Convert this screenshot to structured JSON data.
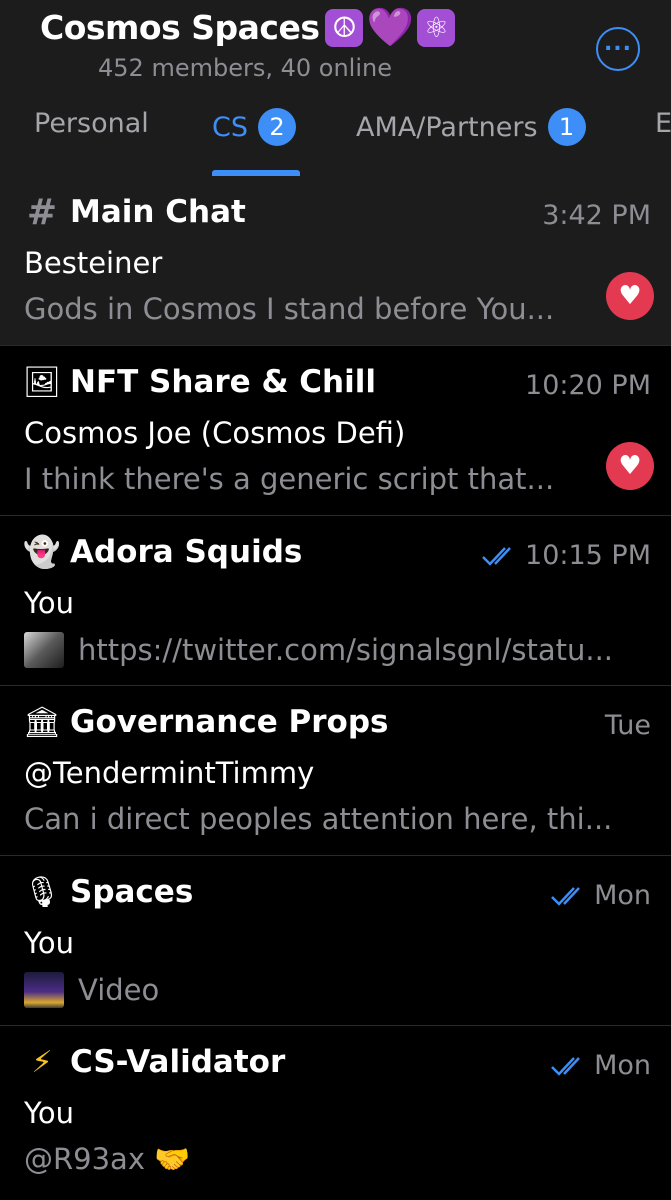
{
  "header": {
    "title": "Cosmos Spaces",
    "title_emojis": [
      "☮",
      "💜",
      "⚛"
    ],
    "subtitle": "452 members, 40 online",
    "more_icon": "ellipsis-circle-icon"
  },
  "tabs": [
    {
      "label": "Personal",
      "badge": ""
    },
    {
      "label": "CS",
      "badge": "2"
    },
    {
      "label": "AMA/Partners",
      "badge": "1"
    },
    {
      "label": "E",
      "badge": ""
    }
  ],
  "active_tab": "CS",
  "accent_color": "#3e8ef7",
  "reaction_color": "#e33a51",
  "chats": [
    {
      "icon": "hash-icon",
      "icon_glyph": "#",
      "name": "Main Chat",
      "time": "3:42 PM",
      "read_check": false,
      "sender": "Besteiner",
      "preview": "Gods in Cosmos I stand before You...",
      "preview_thumb": "",
      "reaction": "heart-icon"
    },
    {
      "icon": "nft-emoji-icon",
      "icon_glyph": "🖼",
      "name": "NFT Share & Chill",
      "time": "10:20 PM",
      "read_check": false,
      "sender": "Cosmos Joe (Cosmos Defi)",
      "preview": "I think there's a generic script that...",
      "preview_thumb": "",
      "reaction": "heart-icon"
    },
    {
      "icon": "squid-emoji-icon",
      "icon_glyph": "👻",
      "name": "Adora Squids",
      "time": "10:15 PM",
      "read_check": true,
      "sender": "You",
      "preview": "https://twitter.com/signalsgnl/statu...",
      "preview_thumb": "twitter-thumb",
      "reaction": ""
    },
    {
      "icon": "bank-emoji-icon",
      "icon_glyph": "🏛",
      "name": "Governance Props",
      "time": "Tue",
      "read_check": false,
      "sender": "@TendermintTimmy",
      "preview": "Can i direct peoples attention here, thi...",
      "preview_thumb": "",
      "reaction": ""
    },
    {
      "icon": "microphone-emoji-icon",
      "icon_glyph": "🎙",
      "name": "Spaces",
      "time": "Mon",
      "read_check": true,
      "sender": "You",
      "preview": "Video",
      "preview_thumb": "video-thumb",
      "reaction": ""
    },
    {
      "icon": "lightning-emoji-icon",
      "icon_glyph": "⚡",
      "name": "CS-Validator",
      "time": "Mon",
      "read_check": true,
      "sender": "You",
      "preview": "@R93ax 🤝",
      "preview_thumb": "",
      "reaction": ""
    }
  ]
}
